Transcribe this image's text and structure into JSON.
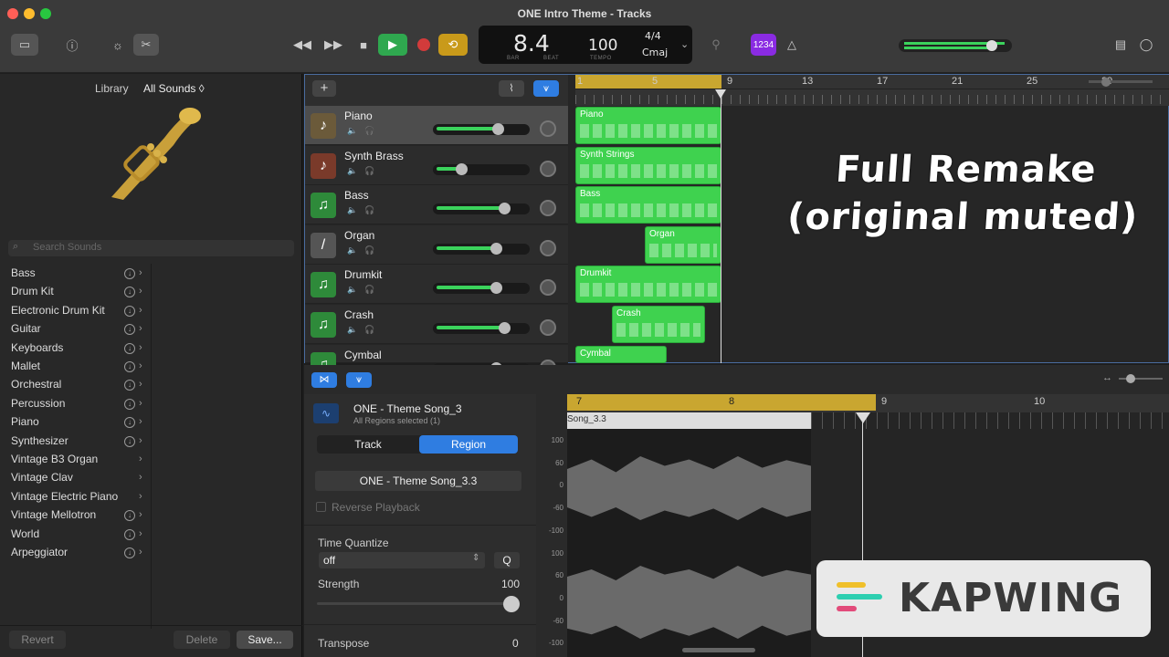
{
  "window": {
    "title": "ONE Intro Theme - Tracks"
  },
  "lcd": {
    "bar_beat": "8.4",
    "bar_label": "BAR",
    "beat_label": "BEAT",
    "tempo": "100",
    "tempo_label": "TEMPO",
    "signature": "4/4",
    "key": "Cmaj"
  },
  "toolbar": {
    "count_in": "1234"
  },
  "library": {
    "title": "Library",
    "filter": "All Sounds ◊",
    "search_placeholder": "Search Sounds",
    "categories": [
      {
        "label": "Bass",
        "dl": true
      },
      {
        "label": "Drum Kit",
        "dl": true
      },
      {
        "label": "Electronic Drum Kit",
        "dl": true
      },
      {
        "label": "Guitar",
        "dl": true
      },
      {
        "label": "Keyboards",
        "dl": true
      },
      {
        "label": "Mallet",
        "dl": true
      },
      {
        "label": "Orchestral",
        "dl": true
      },
      {
        "label": "Percussion",
        "dl": true
      },
      {
        "label": "Piano",
        "dl": true
      },
      {
        "label": "Synthesizer",
        "dl": true
      },
      {
        "label": "Vintage B3 Organ",
        "dl": false
      },
      {
        "label": "Vintage Clav",
        "dl": false
      },
      {
        "label": "Vintage Electric Piano",
        "dl": false
      },
      {
        "label": "Vintage Mellotron",
        "dl": true
      },
      {
        "label": "World",
        "dl": true
      },
      {
        "label": "Arpeggiator",
        "dl": true
      }
    ],
    "revert": "Revert",
    "delete": "Delete",
    "save": "Save..."
  },
  "tracks": [
    {
      "name": "Piano",
      "volume": 0.72
    },
    {
      "name": "Synth Brass",
      "volume": 0.28
    },
    {
      "name": "Bass",
      "volume": 0.8
    },
    {
      "name": "Organ",
      "volume": 0.7
    },
    {
      "name": "Drumkit",
      "volume": 0.7
    },
    {
      "name": "Crash",
      "volume": 0.8
    },
    {
      "name": "Cymbal",
      "volume": 0.7
    }
  ],
  "ruler": {
    "bars": [
      "1",
      "5",
      "9",
      "13",
      "17",
      "21",
      "25",
      "29"
    ]
  },
  "regions": [
    "Piano",
    "Synth Strings",
    "Bass",
    "Organ",
    "Drumkit",
    "Crash",
    "Cymbal"
  ],
  "editor": {
    "region_name": "ONE - Theme Song_3",
    "region_sub": "All Regions selected (1)",
    "tab_track": "Track",
    "tab_region": "Region",
    "region_field": "ONE - Theme Song_3.3",
    "reverse": "Reverse Playback",
    "time_quantize": "Time Quantize",
    "quantize_value": "off",
    "q_button": "Q",
    "strength": "Strength",
    "strength_value": "100",
    "transpose": "Transpose",
    "transpose_value": "0",
    "ruler": [
      "7",
      "8",
      "9",
      "10"
    ],
    "clip_label": "Song_3.3",
    "db_scale": [
      "100",
      "60",
      "0",
      "-60",
      "-100",
      "100",
      "60",
      "0",
      "-60",
      "-100"
    ]
  },
  "overlay": {
    "line1": "Full Remake",
    "line2": "(original muted)"
  },
  "watermark": {
    "text": "KAPWING"
  }
}
